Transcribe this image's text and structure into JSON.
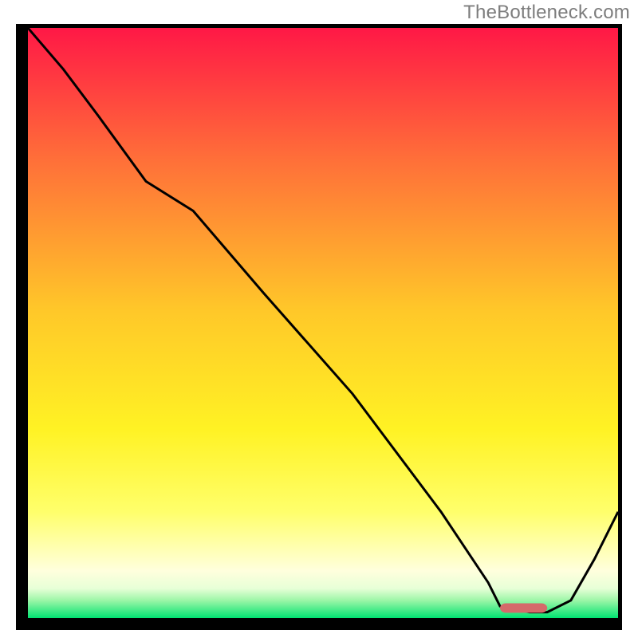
{
  "watermark": "TheBottleneck.com",
  "chart_data": {
    "type": "line",
    "title": "",
    "xlabel": "",
    "ylabel": "",
    "xlim": [
      0,
      100
    ],
    "ylim": [
      0,
      100
    ],
    "grid": false,
    "legend": false,
    "background_gradient_stops": [
      {
        "pct": 0,
        "hex": "#ff1846"
      },
      {
        "pct": 22,
        "hex": "#ff6e39"
      },
      {
        "pct": 48,
        "hex": "#ffc829"
      },
      {
        "pct": 68,
        "hex": "#fff224"
      },
      {
        "pct": 82,
        "hex": "#ffff6b"
      },
      {
        "pct": 92,
        "hex": "#ffffdd"
      },
      {
        "pct": 95,
        "hex": "#e7ffd7"
      },
      {
        "pct": 97,
        "hex": "#9cf6a7"
      },
      {
        "pct": 100,
        "hex": "#00e371"
      }
    ],
    "series": [
      {
        "name": "bottleneck-curve",
        "stroke": "#000000",
        "x": [
          0,
          6,
          12,
          20,
          28,
          40,
          55,
          70,
          78,
          80,
          85,
          88,
          92,
          96,
          100
        ],
        "values": [
          100,
          93,
          85,
          74,
          69,
          55,
          38,
          18,
          6,
          2,
          1,
          1,
          3,
          10,
          18
        ]
      }
    ],
    "marker": {
      "name": "optimal-range",
      "color": "#d56a6a",
      "x_start": 80,
      "x_end": 88,
      "y": 1.7,
      "thickness_pct": 1.6
    }
  }
}
